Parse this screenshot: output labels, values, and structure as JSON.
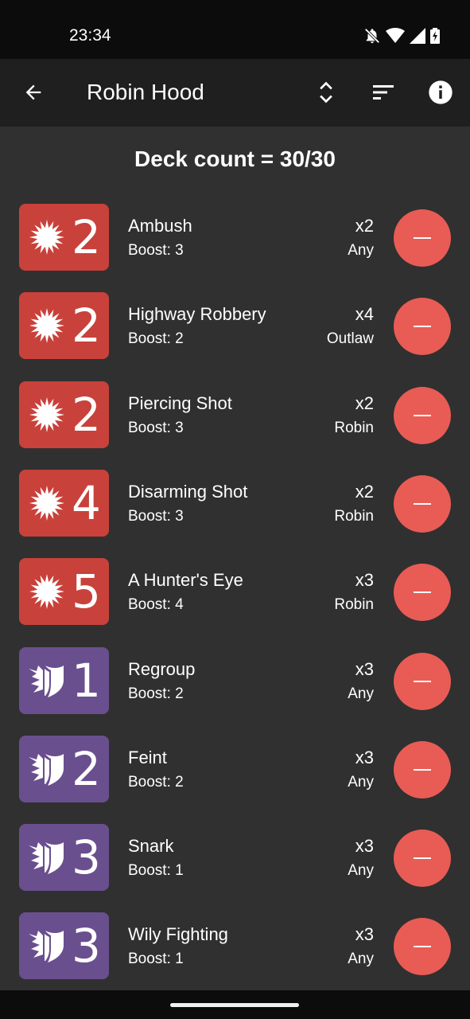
{
  "status_bar": {
    "time": "23:34"
  },
  "app_bar": {
    "title": "Robin Hood"
  },
  "deck_count": "Deck count = 30/30",
  "colors": {
    "attack": "#c9413b",
    "defense": "#6a4f8f",
    "remove": "#e85c55"
  },
  "cards": [
    {
      "type": "attack",
      "icon": "burst-icon",
      "value": "2",
      "name": "Ambush",
      "boost": "Boost: 3",
      "qty": "x2",
      "character": "Any"
    },
    {
      "type": "attack",
      "icon": "burst-icon",
      "value": "2",
      "name": "Highway Robbery",
      "boost": "Boost: 2",
      "qty": "x4",
      "character": "Outlaw"
    },
    {
      "type": "attack",
      "icon": "burst-icon",
      "value": "2",
      "name": "Piercing Shot",
      "boost": "Boost: 3",
      "qty": "x2",
      "character": "Robin"
    },
    {
      "type": "attack",
      "icon": "burst-icon",
      "value": "4",
      "name": "Disarming Shot",
      "boost": "Boost: 3",
      "qty": "x2",
      "character": "Robin"
    },
    {
      "type": "attack",
      "icon": "burst-icon",
      "value": "5",
      "name": "A Hunter's Eye",
      "boost": "Boost: 4",
      "qty": "x3",
      "character": "Robin"
    },
    {
      "type": "defense",
      "icon": "shield-icon",
      "value": "1",
      "name": "Regroup",
      "boost": "Boost: 2",
      "qty": "x3",
      "character": "Any"
    },
    {
      "type": "defense",
      "icon": "shield-icon",
      "value": "2",
      "name": "Feint",
      "boost": "Boost: 2",
      "qty": "x3",
      "character": "Any"
    },
    {
      "type": "defense",
      "icon": "shield-icon",
      "value": "3",
      "name": "Snark",
      "boost": "Boost: 1",
      "qty": "x3",
      "character": "Any"
    },
    {
      "type": "defense",
      "icon": "shield-icon",
      "value": "3",
      "name": "Wily Fighting",
      "boost": "Boost: 1",
      "qty": "x3",
      "character": "Any"
    }
  ]
}
